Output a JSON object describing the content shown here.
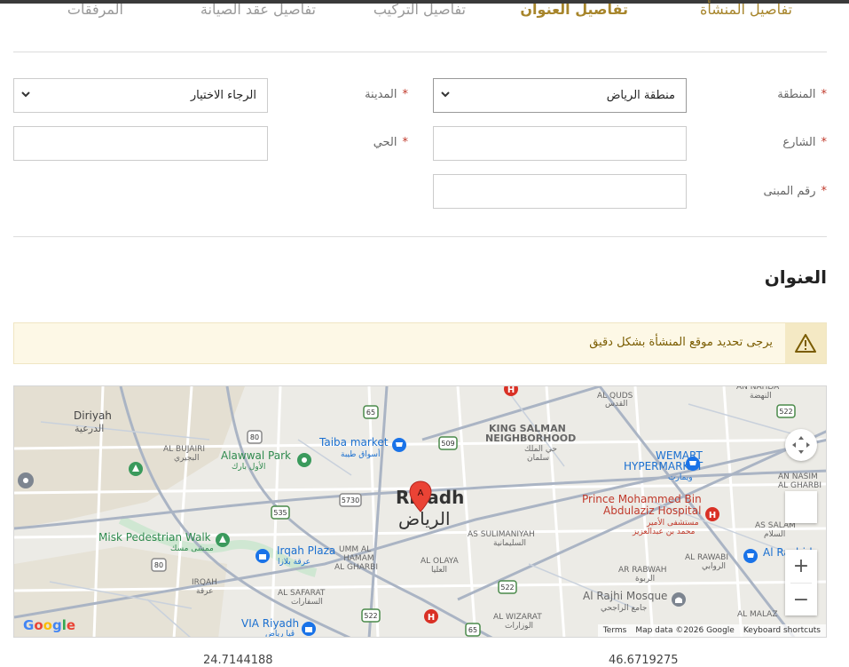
{
  "tabs": [
    {
      "label": "تفاصيل المنشأة",
      "state": "done"
    },
    {
      "label": "تفاصيل العنوان",
      "state": "active"
    },
    {
      "label": "تفاصيل التركيب",
      "state": "pending"
    },
    {
      "label": "تفاصيل عقد الصيانة",
      "state": "pending"
    },
    {
      "label": "المرفقات",
      "state": "pending"
    }
  ],
  "form": {
    "region_label": "المنطقة",
    "region_value": "منطقة الرياض",
    "city_label": "المدينة",
    "city_value": "الرجاء الاختيار",
    "street_label": "الشارع",
    "street_value": "",
    "district_label": "الحي",
    "district_value": "",
    "building_label": "رقم المبنى",
    "building_value": "",
    "required_mark": "*"
  },
  "section_title": "العنوان",
  "alert": {
    "text": "يرجى تحديد موقع المنشأة بشكل دقيق",
    "icon": "warning-icon"
  },
  "map": {
    "labels": {
      "diriyah": "Diriyah",
      "diriyah_ar": "الدرعية",
      "al_bujairi": "AL BUJAIRI",
      "al_bujairi_ar": "البجيري",
      "alawwal_park": "Alawwal Park",
      "alawwal_park_ar": "الأول بارك",
      "taiba_market": "Taiba market",
      "taiba_market_ar": "أسواق طيبة",
      "king_salman_1": "KING SALMAN",
      "king_salman_2": "NEIGHBORHOOD",
      "king_salman_ar_1": "حي الملك",
      "king_salman_ar_2": "سلمان",
      "al_quds": "AL QUDS",
      "al_quds_ar": "القدس",
      "an_nadha": "AN NAHDA",
      "an_nadha_ar": "النهضة",
      "wemart_1": "WEMART",
      "wemart_2": "HYPERMARKET",
      "wemart_ar": "ويمارت",
      "riyadh": "Riyadh",
      "riyadh_ar": "الرياض",
      "hospital_1": "Prince Mohammed Bin",
      "hospital_2": "Abdulaziz Hospital",
      "hospital_ar_1": "مستشفى الأمير",
      "hospital_ar_2": "محمد بن عبدالعزيز",
      "an_nasim_1": "AN NASIM",
      "an_nasim_2": "AL GHARBI",
      "as_salam": "AS SALAM",
      "as_salam_ar": "السلام",
      "al_rawabi": "AL RAWABI",
      "al_rawabi_ar": "الروابي",
      "misk_walk": "Misk Pedestrian Walk",
      "misk_walk_ar": "ممشى مسك",
      "irqah_plaza": "Irqah Plaza",
      "irqah_plaza_ar": "عرقة بلازا",
      "umm_al_hamam_1": "UMM AL",
      "umm_al_hamam_2": "HAMAM",
      "umm_al_hamam_3": "AL GHARBI",
      "as_sulimaniyah": "AS SULIMANIYAH",
      "as_sulimaniyah_ar": "السليمانية",
      "al_olaya": "AL OLAYA",
      "al_olaya_ar": "العليا",
      "ar_rabwah": "AR RABWAH",
      "ar_rabwah_ar": "الربوة",
      "al_rajhi_mosque": "Al Rajhi Mosque",
      "al_rajhi_mosque_ar": "جامع الراجحي",
      "irqah": "IRQAH",
      "irqah_ar": "عرقة",
      "al_safarat": "AL SAFARAT",
      "al_safarat_ar": "السفارات",
      "via_riyadh": "VIA Riyadh",
      "via_riyadh_ar": "ڤيا رياض",
      "al_wizarat": "AL WIZARAT",
      "al_wizarat_ar": "الوزارات",
      "al_malaz": "AL MALAZ",
      "al_rashid": "Al Rashid",
      "marker": "A",
      "road_65": "65",
      "road_80": "80",
      "road_5730": "5730",
      "road_509": "509",
      "road_522": "522",
      "road_535": "535"
    },
    "google": "Google",
    "terms": "Terms",
    "map_data": "Map data ©2026 Google",
    "shortcuts": "Keyboard shortcuts",
    "zoom_in": "+",
    "zoom_out": "−"
  },
  "coords": {
    "longitude": "24.7144188",
    "latitude": "46.6719275"
  }
}
